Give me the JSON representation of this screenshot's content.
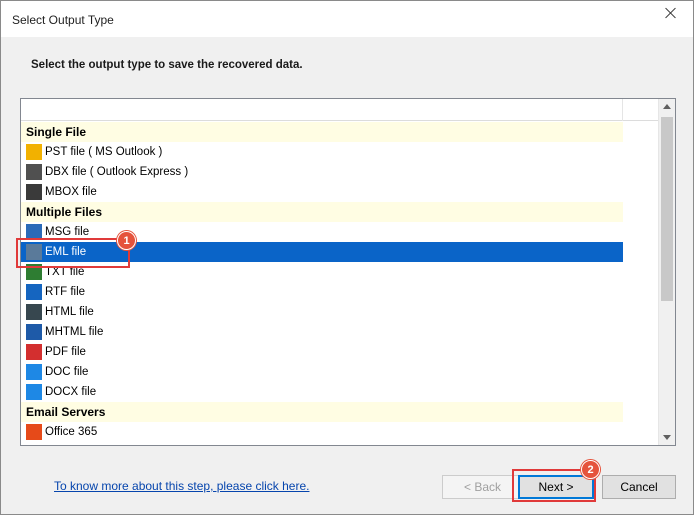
{
  "window": {
    "title": "Select Output Type"
  },
  "instruction": "Select the output type to save the recovered data.",
  "list": {
    "groups": [
      {
        "label": "Single File",
        "items": [
          {
            "label": "PST file ( MS Outlook )",
            "icon": "pst-icon",
            "color": "#f2b100"
          },
          {
            "label": "DBX file ( Outlook Express )",
            "icon": "dbx-icon",
            "color": "#505050"
          },
          {
            "label": "MBOX file",
            "icon": "mbox-icon",
            "color": "#3a3a3a"
          }
        ]
      },
      {
        "label": "Multiple Files",
        "items": [
          {
            "label": "MSG file",
            "icon": "msg-icon",
            "color": "#2a6ab8"
          },
          {
            "label": "EML file",
            "icon": "eml-icon",
            "color": "#5a7a9a",
            "selected": true
          },
          {
            "label": "TXT file",
            "icon": "txt-icon",
            "color": "#2e7d32"
          },
          {
            "label": "RTF file",
            "icon": "rtf-icon",
            "color": "#1565c0"
          },
          {
            "label": "HTML file",
            "icon": "html-icon",
            "color": "#37474f"
          },
          {
            "label": "MHTML file",
            "icon": "mhtml-icon",
            "color": "#1e5aa8"
          },
          {
            "label": "PDF file",
            "icon": "pdf-icon",
            "color": "#d32f2f"
          },
          {
            "label": "DOC file",
            "icon": "doc-icon",
            "color": "#1e88e5"
          },
          {
            "label": "DOCX file",
            "icon": "docx-icon",
            "color": "#1e88e5"
          }
        ]
      },
      {
        "label": "Email Servers",
        "items": [
          {
            "label": "Office 365",
            "icon": "office365-icon",
            "color": "#e64a19"
          }
        ]
      }
    ]
  },
  "help_link": "To know more about this step, please click here.",
  "buttons": {
    "back": "< Back",
    "next": "Next >",
    "cancel": "Cancel"
  },
  "callouts": {
    "one": "1",
    "two": "2"
  },
  "colors": {
    "selection": "#0a64c8",
    "group_bg": "#fffde3",
    "callout": "#e03a3a"
  }
}
